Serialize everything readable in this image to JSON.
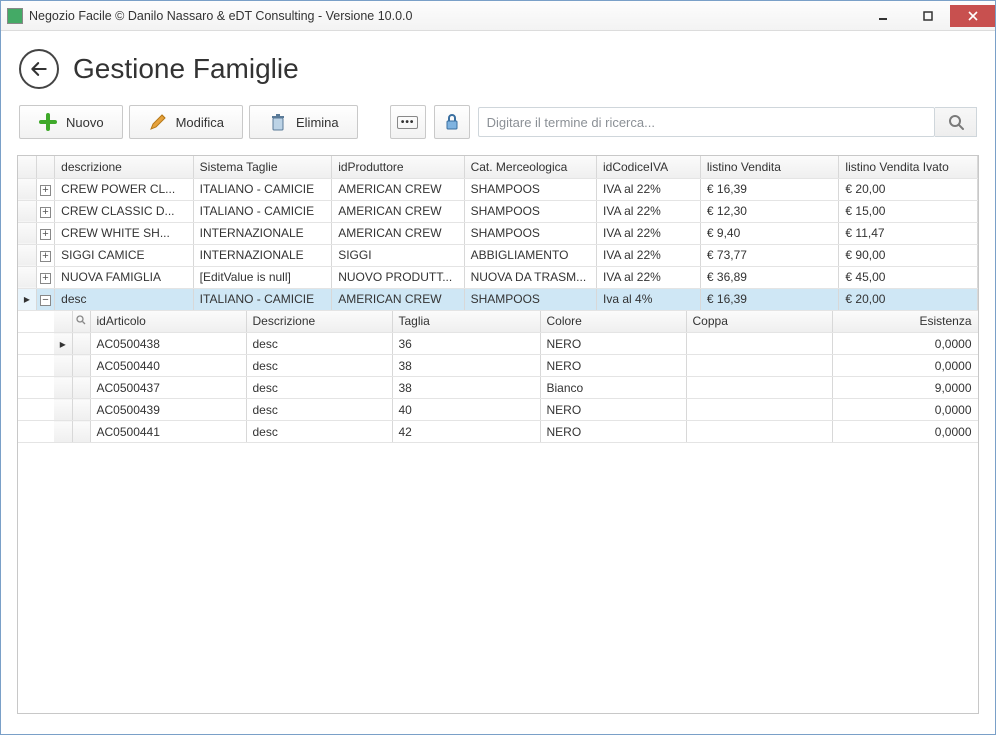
{
  "window": {
    "title": "Negozio Facile © Danilo Nassaro & eDT Consulting - Versione 10.0.0"
  },
  "header": {
    "page_title": "Gestione Famiglie"
  },
  "toolbar": {
    "nuovo": "Nuovo",
    "modifica": "Modifica",
    "elimina": "Elimina",
    "search_placeholder": "Digitare il termine di ricerca...",
    "icons": {
      "nuovo": "plus-icon",
      "modifica": "pencil-icon",
      "elimina": "trash-icon",
      "ellipsis": "ellipsis-icon",
      "lock": "lock-icon",
      "search": "search-icon"
    }
  },
  "grid": {
    "columns": {
      "descrizione": "descrizione",
      "sistema_taglie": "Sistema Taglie",
      "id_produttore": "idProduttore",
      "cat_merceologica": "Cat. Merceologica",
      "id_codice_iva": "idCodiceIVA",
      "listino_vendita": "listino Vendita",
      "listino_vendita_ivato": "listino Vendita Ivato"
    },
    "rows": [
      {
        "exp": "+",
        "descrizione": "CREW POWER CL...",
        "sistema": "ITALIANO - CAMICIE",
        "prod": "AMERICAN CREW",
        "cat": "SHAMPOOS",
        "iva": "IVA al 22%",
        "listino": "€ 16,39",
        "listino_iv": "€ 20,00"
      },
      {
        "exp": "+",
        "descrizione": "CREW CLASSIC D...",
        "sistema": "ITALIANO - CAMICIE",
        "prod": "AMERICAN CREW",
        "cat": "SHAMPOOS",
        "iva": "IVA al 22%",
        "listino": "€ 12,30",
        "listino_iv": "€ 15,00"
      },
      {
        "exp": "+",
        "descrizione": "CREW WHITE SH...",
        "sistema": "INTERNAZIONALE",
        "prod": "AMERICAN CREW",
        "cat": "SHAMPOOS",
        "iva": "IVA al 22%",
        "listino": "€ 9,40",
        "listino_iv": "€ 11,47"
      },
      {
        "exp": "+",
        "descrizione": "SIGGI CAMICE",
        "sistema": "INTERNAZIONALE",
        "prod": "SIGGI",
        "cat": "ABBIGLIAMENTO",
        "iva": "IVA al 22%",
        "listino": "€ 73,77",
        "listino_iv": "€ 90,00"
      },
      {
        "exp": "+",
        "descrizione": "NUOVA FAMIGLIA",
        "sistema": "[EditValue is null]",
        "prod": "NUOVO PRODUTT...",
        "cat": "NUOVA DA TRASM...",
        "iva": "IVA al 22%",
        "listino": "€ 36,89",
        "listino_iv": "€ 45,00"
      },
      {
        "exp": "−",
        "descrizione": "desc",
        "sistema": "ITALIANO - CAMICIE",
        "prod": "AMERICAN CREW",
        "cat": "SHAMPOOS",
        "iva": "Iva al 4%",
        "listino": "€ 16,39",
        "listino_iv": "€ 20,00",
        "selected": true
      }
    ]
  },
  "detail": {
    "columns": {
      "id_articolo": "idArticolo",
      "descrizione": "Descrizione",
      "taglia": "Taglia",
      "colore": "Colore",
      "coppa": "Coppa",
      "esistenza": "Esistenza"
    },
    "rows": [
      {
        "id": "AC0500438",
        "desc": "desc",
        "taglia": "36",
        "colore": "NERO",
        "coppa": "",
        "esist": "0,0000"
      },
      {
        "id": "AC0500440",
        "desc": "desc",
        "taglia": "38",
        "colore": "NERO",
        "coppa": "",
        "esist": "0,0000"
      },
      {
        "id": "AC0500437",
        "desc": "desc",
        "taglia": "38",
        "colore": "Bianco",
        "coppa": "",
        "esist": "9,0000"
      },
      {
        "id": "AC0500439",
        "desc": "desc",
        "taglia": "40",
        "colore": "NERO",
        "coppa": "",
        "esist": "0,0000"
      },
      {
        "id": "AC0500441",
        "desc": "desc",
        "taglia": "42",
        "colore": "NERO",
        "coppa": "",
        "esist": "0,0000"
      }
    ]
  }
}
